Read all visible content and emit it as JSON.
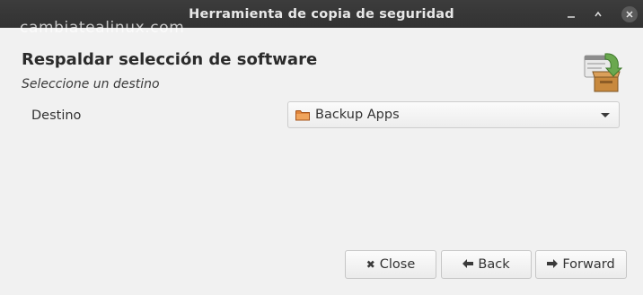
{
  "window": {
    "title": "Herramienta de copia de seguridad",
    "watermark": "cambiatealinux.com",
    "controls": [
      "minimize-icon",
      "maximize-icon",
      "close-icon"
    ]
  },
  "page": {
    "heading": "Respaldar selección de software",
    "subheading": "Seleccione un destino",
    "icon": "backup-box-icon"
  },
  "form": {
    "destination_label": "Destino",
    "destination_value": "Backup Apps",
    "destination_icon": "folder-icon"
  },
  "buttons": {
    "close_label": "Close",
    "back_label": "Back",
    "forward_label": "Forward"
  },
  "colors": {
    "titlebar": "#353535",
    "background": "#f1f1f1",
    "folder": "#e0843a",
    "accent_green": "#6aa84f"
  }
}
